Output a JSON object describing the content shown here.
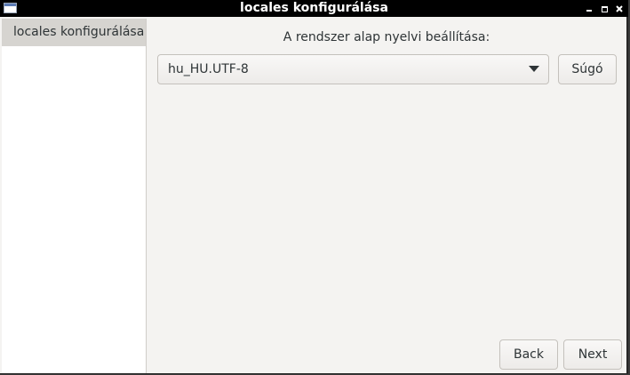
{
  "window": {
    "title": "locales konfigurálása"
  },
  "sidebar": {
    "items": [
      {
        "label": "locales konfigurálása",
        "selected": true
      }
    ]
  },
  "main": {
    "prompt": "A rendszer alap nyelvi beállítása:",
    "locale_select": {
      "value": "hu_HU.UTF-8"
    },
    "help_label": "Súgó"
  },
  "footer": {
    "back_label": "Back",
    "next_label": "Next"
  },
  "colors": {
    "titlebar": "#000000",
    "window_bg": "#f4f3f1",
    "sidebar_bg": "#ffffff",
    "sidebar_selected_bg": "#d6d4d0",
    "text": "#2e3436"
  }
}
